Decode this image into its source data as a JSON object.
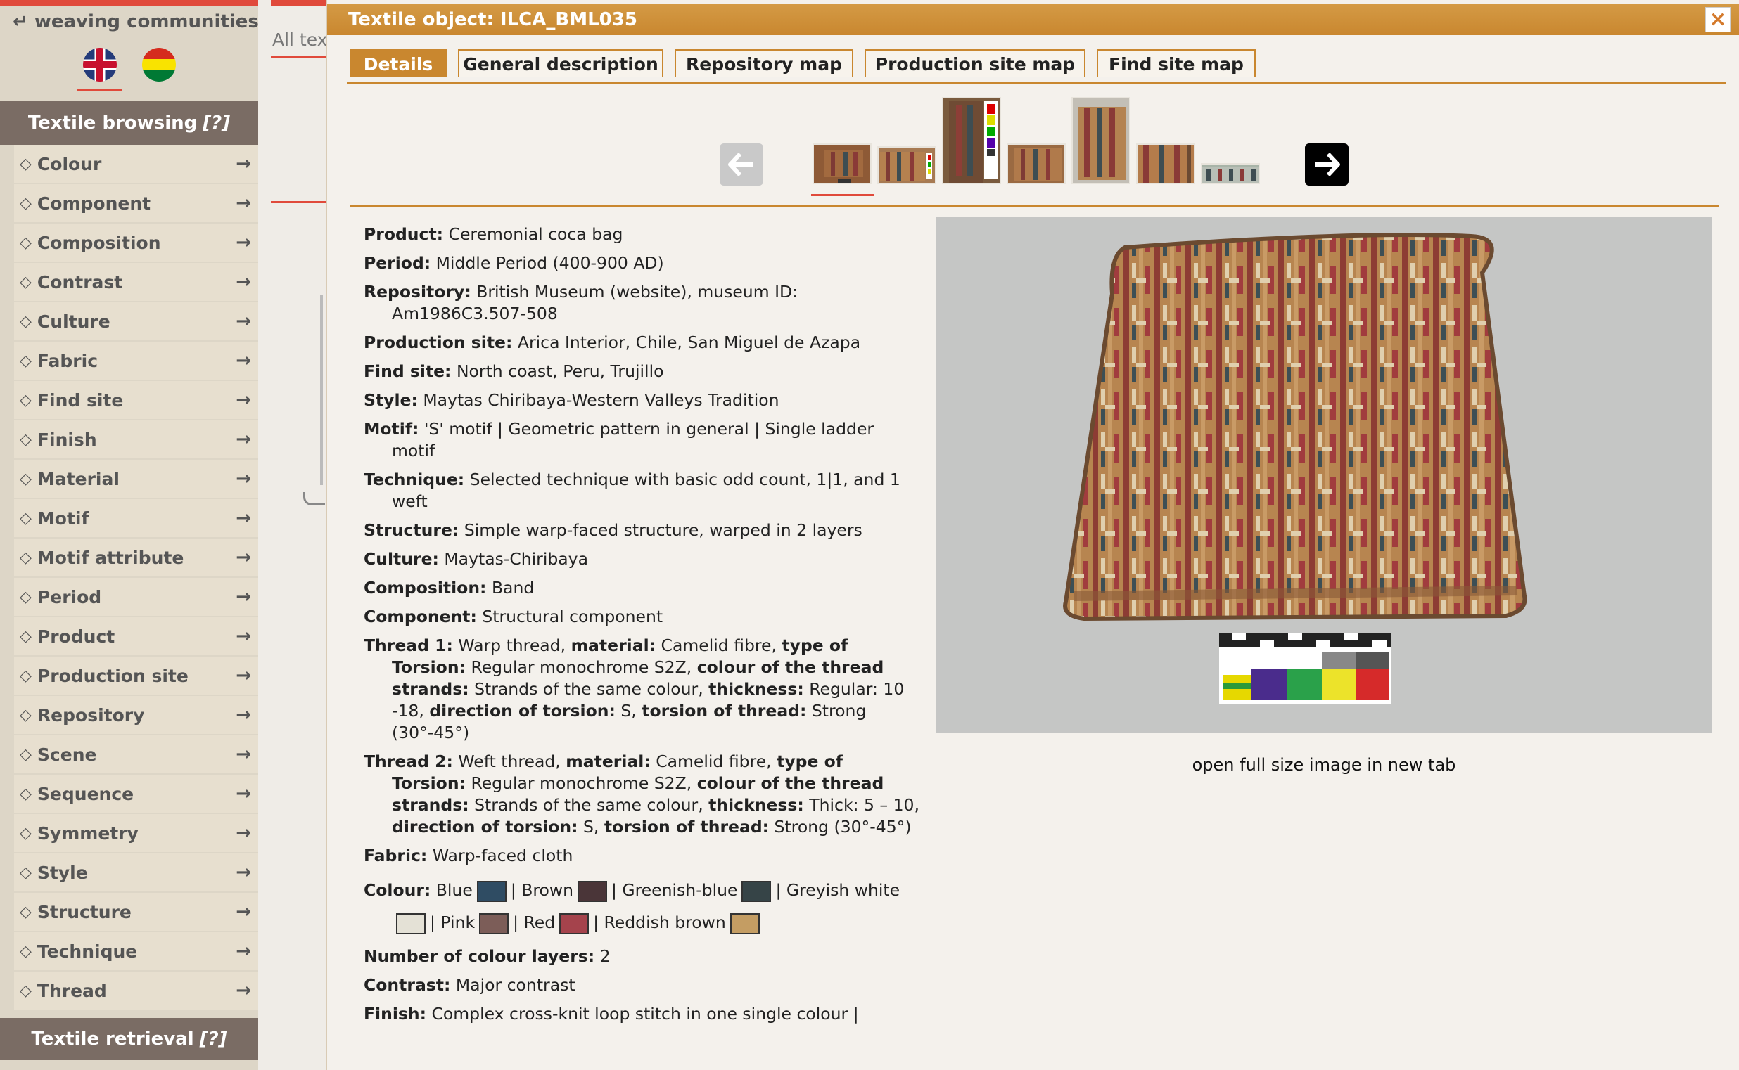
{
  "sidebar": {
    "back_link": "↵ weaving communities",
    "browsing_header": "Textile browsing",
    "browsing_help": "[?]",
    "retrieval_header": "Textile retrieval",
    "retrieval_help": "[?]",
    "items": [
      {
        "label": "Colour"
      },
      {
        "label": "Component"
      },
      {
        "label": "Composition"
      },
      {
        "label": "Contrast"
      },
      {
        "label": "Culture"
      },
      {
        "label": "Fabric"
      },
      {
        "label": "Find site"
      },
      {
        "label": "Finish"
      },
      {
        "label": "Material"
      },
      {
        "label": "Motif"
      },
      {
        "label": "Motif attribute"
      },
      {
        "label": "Period"
      },
      {
        "label": "Product"
      },
      {
        "label": "Production site"
      },
      {
        "label": "Repository"
      },
      {
        "label": "Scene"
      },
      {
        "label": "Sequence"
      },
      {
        "label": "Symmetry"
      },
      {
        "label": "Style"
      },
      {
        "label": "Structure"
      },
      {
        "label": "Technique"
      },
      {
        "label": "Thread"
      }
    ]
  },
  "background": {
    "partial_text": "All tex"
  },
  "modal": {
    "title": "Textile object: ILCA_BML035",
    "close": "×",
    "tabs": [
      "Details",
      "General description",
      "Repository map",
      "Production site map",
      "Find site map"
    ],
    "open_full_image": "open full size image in new tab"
  },
  "details": {
    "product_label": "Product:",
    "product": "Ceremonial coca bag",
    "period_label": "Period:",
    "period": "Middle Period (400-900 AD)",
    "repository_label": "Repository:",
    "repository": "British Museum (website), museum ID: Am1986C3.507-508",
    "production_site_label": "Production site:",
    "production_site": "Arica Interior, Chile, San Miguel de Azapa",
    "find_site_label": "Find site:",
    "find_site": "North coast, Peru, Trujillo",
    "style_label": "Style:",
    "style": "Maytas Chiribaya-Western Valleys Tradition",
    "motif_label": "Motif:",
    "motif": "'S' motif | Geometric pattern in general | Single ladder motif",
    "technique_label": "Technique:",
    "technique": "Selected technique with basic odd count, 1|1, and 1 weft",
    "structure_label": "Structure:",
    "structure": "Simple warp-faced structure, warped in 2 layers",
    "culture_label": "Culture:",
    "culture": "Maytas-Chiribaya",
    "composition_label": "Composition:",
    "composition": "Band",
    "component_label": "Component:",
    "component": "Structural component",
    "thread1": {
      "label": "Thread 1:",
      "type": "Warp thread,",
      "material_label": "material:",
      "material": "Camelid fibre,",
      "torsion_type_label": "type of Torsion:",
      "torsion_type": "Regular monochrome S2Z,",
      "colour_strands_label": "colour of the thread strands:",
      "colour_strands": "Strands of the same colour,",
      "thickness_label": "thickness:",
      "thickness": "Regular: 10 -18,",
      "direction_label": "direction of torsion:",
      "direction": "S,",
      "torsion_label": "torsion of thread:",
      "torsion": "Strong (30°-45°)"
    },
    "thread2": {
      "label": "Thread 2:",
      "type": "Weft thread,",
      "material_label": "material:",
      "material": "Camelid fibre,",
      "torsion_type_label": "type of Torsion:",
      "torsion_type": "Regular monochrome S2Z,",
      "colour_strands_label": "colour of the thread strands:",
      "colour_strands": "Strands of the same colour,",
      "thickness_label": "thickness:",
      "thickness": "Thick: 5 – 10,",
      "direction_label": "direction of torsion:",
      "direction": "S,",
      "torsion_label": "torsion of thread:",
      "torsion": "Strong (30°-45°)"
    },
    "fabric_label": "Fabric:",
    "fabric": "Warp-faced cloth",
    "colour_label": "Colour:",
    "colours": [
      {
        "name": "Blue",
        "hex": "#2f4c63"
      },
      {
        "name": "Brown",
        "hex": "#4a3538"
      },
      {
        "name": "Greenish-blue",
        "hex": "#364447"
      },
      {
        "name": "Greyish white",
        "hex": "#e4e1d6"
      },
      {
        "name": "Pink",
        "hex": "#7c5d58"
      },
      {
        "name": "Red",
        "hex": "#a5434c"
      },
      {
        "name": "Reddish brown",
        "hex": "#c49d63"
      }
    ],
    "colour_layers_label": "Number of colour layers:",
    "colour_layers": "2",
    "contrast_label": "Contrast:",
    "contrast": "Major contrast",
    "finish_label": "Finish:",
    "finish": "Complex cross-knit loop stitch in one single colour |"
  },
  "colors": {
    "accent": "#c9872f",
    "sidebar_header": "#7a6c64",
    "red_line": "#e04a3b"
  }
}
